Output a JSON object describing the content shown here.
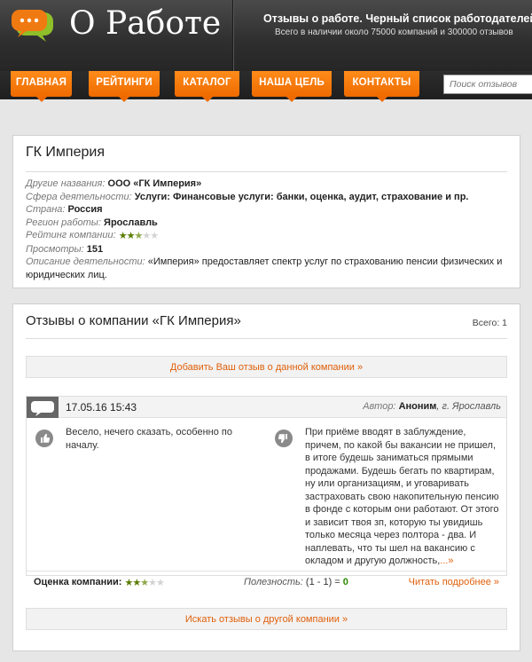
{
  "header": {
    "logo_text": "О Работе",
    "tagline": "Отзывы о работе. Черный список работодателей",
    "subline": "Всего в наличии около 75000 компаний и 300000 отзывов"
  },
  "nav": {
    "items": [
      "ГЛАВНАЯ",
      "РЕЙТИНГИ",
      "КАТАЛОГ",
      "НАША ЦЕЛЬ",
      "КОНТАКТЫ"
    ],
    "search_placeholder": "Поиск отзывов"
  },
  "colors": {
    "accent": "#ee6a00",
    "link": "#e0600b",
    "header_bg": "#2e2e2e",
    "star": "#5a7d00"
  },
  "company": {
    "title": "ГК Империя",
    "rows": [
      {
        "label": "Другие названия:",
        "value": "ООО «ГК Империя»"
      },
      {
        "label": "Сфера деятельности:",
        "value": "Услуги: Финансовые услуги: банки, оценка, аудит, страхование и пр."
      },
      {
        "label": "Страна:",
        "value": "Россия"
      },
      {
        "label": "Регион работы:",
        "value": "Ярославль"
      },
      {
        "label": "Рейтинг компании:",
        "rating": 2.5,
        "rating_max": 5
      },
      {
        "label": "Просмотры:",
        "value": "151"
      },
      {
        "label": "Описание деятельности:",
        "value": "«Империя» предоставляет спектр услуг по страхованию пенсии физических и юридических лиц."
      }
    ]
  },
  "reviews": {
    "title": "Отзывы о компании «ГК Империя»",
    "total": "Всего: 1",
    "add_link": "Добавить Ваш отзыв о данной компании »",
    "search_other": "Искать отзывы о другой компании »",
    "items": [
      {
        "date": "17.05.16 15:43",
        "author_label": "Автор:",
        "author_name": "Аноним",
        "author_city": ", г. Ярославль",
        "pro_icon": "thumbs-up-icon",
        "con_icon": "thumbs-down-icon",
        "pro": "Весело, нечего сказать, особенно по началу.",
        "con": "При приёме вводят в заблуждение, причем, по какой бы вакансии не пришел, в итоге будешь заниматься прямыми продажами. Будешь бегать по квартирам, ну или организациям, и уговаривать застраховать свою накопительную пенсию в фонде с которым они работают. От этого и зависит твоя зп, которую ты увидишь только месяца через полтора - два. И наплевать, что ты шел на вакансию с окладом и другую должность,",
        "con_more": "...»",
        "rating_label": "Оценка компании:",
        "rating": 2.5,
        "rating_max": 5,
        "usefulness_label": "Полезность:",
        "usefulness_value": "(1 - 1) =",
        "usefulness_result": "0",
        "read_more": "Читать подробнее »"
      }
    ]
  }
}
